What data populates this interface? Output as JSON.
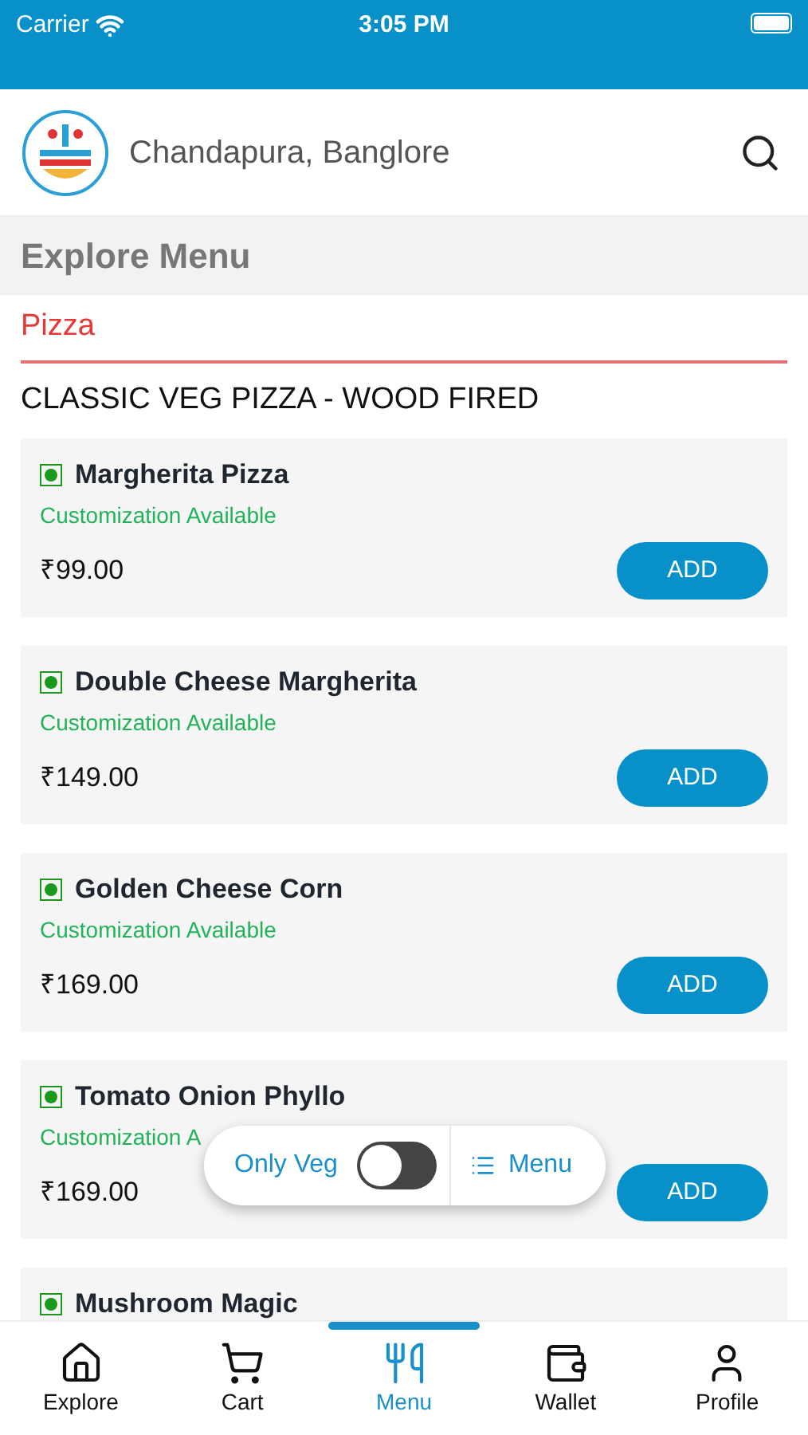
{
  "status_bar": {
    "carrier": "Carrier",
    "time": "3:05 PM"
  },
  "header": {
    "location": "Chandapura, Banglore"
  },
  "page_title": "Explore Menu",
  "category_tabs": [
    {
      "label": "Pizza",
      "selected": true
    }
  ],
  "section_title": "CLASSIC VEG PIZZA - WOOD FIRED",
  "items": [
    {
      "name": "Margherita Pizza",
      "veg": true,
      "note": "Customization Available",
      "price": "₹99.00",
      "button": "ADD"
    },
    {
      "name": "Double Cheese Margherita",
      "veg": true,
      "note": "Customization Available",
      "price": "₹149.00",
      "button": "ADD"
    },
    {
      "name": "Golden Cheese Corn",
      "veg": true,
      "note": "Customization Available",
      "price": "₹169.00",
      "button": "ADD"
    },
    {
      "name": "Tomato Onion Phyllo",
      "veg": true,
      "note": "Customization A",
      "price": "₹169.00",
      "button": "ADD"
    },
    {
      "name": "Mushroom Magic",
      "veg": true
    }
  ],
  "floating_bar": {
    "veg_label": "Only Veg",
    "veg_only_on": false,
    "menu_label": "Menu"
  },
  "bottom_nav": [
    {
      "kind": "home",
      "label": "Explore",
      "selected": false
    },
    {
      "kind": "cart",
      "label": "Cart",
      "selected": false
    },
    {
      "kind": "menu",
      "label": "Menu",
      "selected": true
    },
    {
      "kind": "wallet",
      "label": "Wallet",
      "selected": false
    },
    {
      "kind": "profile",
      "label": "Profile",
      "selected": false
    }
  ]
}
